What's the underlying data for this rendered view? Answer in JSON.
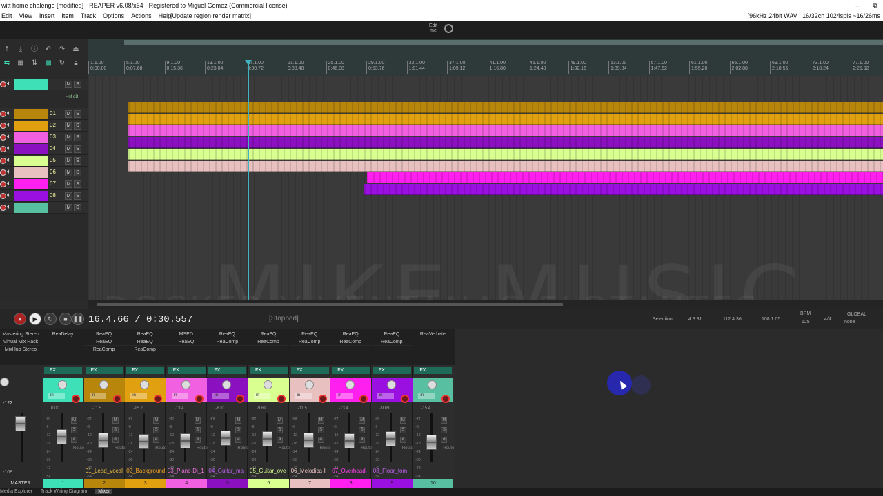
{
  "window": {
    "title": "witt home chalenge [modified] - REAPER v6.08/x64 - Registered to Miguel Gomez (Commercial license)",
    "buttons": [
      "–",
      "⧉"
    ]
  },
  "menu": {
    "items": [
      "Edit",
      "View",
      "Insert",
      "Item",
      "Track",
      "Options",
      "Actions",
      "Help"
    ],
    "action_hint": "[Update region render matrix]",
    "status": "[96kHz 24bit WAV : 16/32ch 1024spls ~16/26ms"
  },
  "toolbar": {
    "edit_label": "Edit\nme"
  },
  "ruler": {
    "ticks": [
      {
        "bar": "1.1.00",
        "time": "0:00.00"
      },
      {
        "bar": "5.1.00",
        "time": "0:07.68"
      },
      {
        "bar": "9.1.00",
        "time": "0:15.36"
      },
      {
        "bar": "13.1.00",
        "time": "0:23.04"
      },
      {
        "bar": "17.1.00",
        "time": "0:30.72"
      },
      {
        "bar": "21.1.00",
        "time": "0:38.40"
      },
      {
        "bar": "25.1.00",
        "time": "0:46.08"
      },
      {
        "bar": "29.1.00",
        "time": "0:53.76"
      },
      {
        "bar": "33.1.00",
        "time": "1:01.44"
      },
      {
        "bar": "37.1.00",
        "time": "1:09.12"
      },
      {
        "bar": "41.1.00",
        "time": "1:16.80"
      },
      {
        "bar": "45.1.00",
        "time": "1:24.48"
      },
      {
        "bar": "49.1.00",
        "time": "1:32.16"
      },
      {
        "bar": "53.1.00",
        "time": "1:39.84"
      },
      {
        "bar": "57.1.00",
        "time": "1:47.52"
      },
      {
        "bar": "61.1.00",
        "time": "1:55.20"
      },
      {
        "bar": "65.1.00",
        "time": "2:02.88"
      },
      {
        "bar": "69.1.00",
        "time": "2:10.56"
      },
      {
        "bar": "73.1.00",
        "time": "2:18.24"
      },
      {
        "bar": "77.1.00",
        "time": "2:25.92"
      }
    ]
  },
  "tracks": [
    {
      "num": "",
      "color": "#3ee0b8"
    },
    {
      "num": "01",
      "color": "#b8860b"
    },
    {
      "num": "02",
      "color": "#e0a010"
    },
    {
      "num": "03",
      "color": "#f060e0"
    },
    {
      "num": "04",
      "color": "#8a10c0"
    },
    {
      "num": "05",
      "color": "#d8ff90"
    },
    {
      "num": "06",
      "color": "#e8c0c0"
    },
    {
      "num": "07",
      "color": "#ff20f0"
    },
    {
      "num": "08",
      "color": "#9a10e0"
    },
    {
      "num": "",
      "color": "#58c0a0"
    }
  ],
  "master_db": "-inf dB",
  "watermark": {
    "line1": "MIKE MUSIC",
    "line2": "DOCKER Y VENTANAS FLOTANTES"
  },
  "transport": {
    "time": "16.4.66 / 0:30.557",
    "state": "[Stopped]",
    "selection_label": "Selection:",
    "sel_start": "4.3.31",
    "sel_end": "112.4.36",
    "sel_len": "108.1.05",
    "bpm_label": "BPM",
    "bpm": "125",
    "timesig": "4/4",
    "global_label": "GLOBAL",
    "global_value": "none"
  },
  "master_fx": [
    "Mastering Stereo",
    "Virtual Mix Rack",
    "MixHub Stereo"
  ],
  "fx_columns": [
    [
      "ReaDelay"
    ],
    [
      "ReaEQ",
      "ReaEQ",
      "ReaComp"
    ],
    [
      "ReaEQ",
      "ReaEQ",
      "ReaComp"
    ],
    [
      "MSED",
      "ReaEQ"
    ],
    [
      "ReaEQ",
      "ReaComp"
    ],
    [
      "ReaEQ",
      "ReaComp"
    ],
    [
      "ReaEQ",
      "ReaComp"
    ],
    [
      "ReaEQ",
      "ReaComp"
    ],
    [
      "ReaEQ",
      "ReaComp"
    ],
    [
      "ReaVerbate"
    ]
  ],
  "mixer": {
    "fx_label": "FX",
    "in_label": "in",
    "route_label": "Route",
    "master_label": "MASTER",
    "master_vol": "-122",
    "master_bottom": "-108",
    "scale": [
      "-inf",
      "-6",
      "-12",
      "-18",
      "-24",
      "-30",
      "-42",
      "-54"
    ],
    "strips": [
      {
        "vol": "0.00",
        "name": "",
        "num": "1",
        "color": "#3ee0b8",
        "name_color": "#3ee0b8",
        "level": 0.55
      },
      {
        "vol": "-11.5",
        "name": "01_Lead_vocal",
        "num": "2",
        "color": "#b8860b",
        "name_color": "#f0c040",
        "level": 0.45
      },
      {
        "vol": "-15.2",
        "name": "02_Background",
        "num": "3",
        "color": "#e0a010",
        "name_color": "#f0a020",
        "level": 0.4
      },
      {
        "vol": "-13.4",
        "name": "03_Piano-Di_1",
        "num": "4",
        "color": "#f060e0",
        "name_color": "#f070e0",
        "level": 0.42
      },
      {
        "vol": "-8.81",
        "name": "04_Guitar_ma",
        "num": "5",
        "color": "#8a10c0",
        "name_color": "#c060f0",
        "level": 0.5
      },
      {
        "vol": "-9.69",
        "name": "05_Guitar_ove",
        "num": "6",
        "color": "#d8ff90",
        "name_color": "#d8ff90",
        "level": 0.48
      },
      {
        "vol": "-11.5",
        "name": "06_Melodica-I",
        "num": "7",
        "color": "#e8c0c0",
        "name_color": "#e8c0c0",
        "level": 0.45
      },
      {
        "vol": "-13.4",
        "name": "07_Overhead-",
        "num": "8",
        "color": "#ff20f0",
        "name_color": "#ff40f0",
        "level": 0.42
      },
      {
        "vol": "-9.69",
        "name": "08_Floor_tom",
        "num": "9",
        "color": "#9a10e0",
        "name_color": "#c060f0",
        "level": 0.48
      },
      {
        "vol": "-15.4",
        "name": "",
        "num": "10",
        "color": "#58c0a0",
        "name_color": "#58c0a0",
        "level": 0.38
      }
    ]
  },
  "bottom_tabs": [
    "Media Explorer",
    "Track Wiring Diagram",
    "Mixer"
  ]
}
